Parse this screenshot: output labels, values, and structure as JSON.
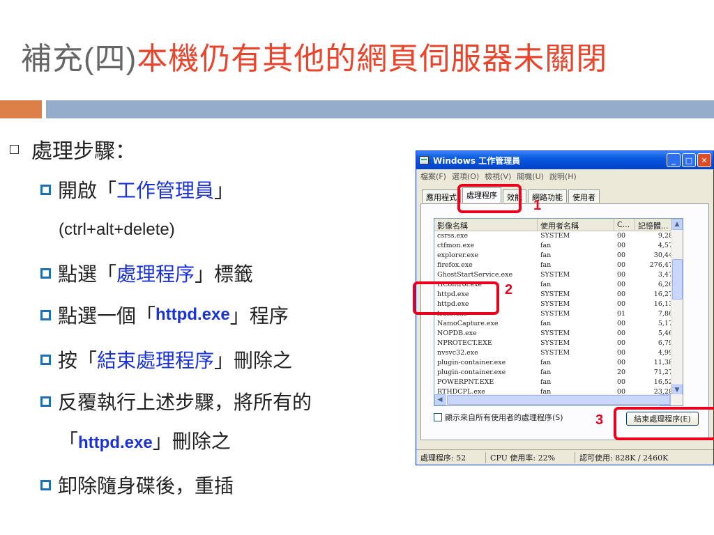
{
  "title": {
    "part1": "補充",
    "part2": "(四)",
    "part3": "本機仍有其他的網頁伺服器未關閉"
  },
  "colors": {
    "accent_orange": "#dd8047",
    "accent_blue": "#94abc9",
    "highlight_red": "#e8001c",
    "link_blue": "#1a32d8"
  },
  "steps": {
    "heading": "處理步驟：",
    "s1": {
      "pre": "開啟「",
      "hl": "工作管理員",
      "post": "」",
      "note": "(ctrl+alt+delete)"
    },
    "s2": {
      "pre": "點選「",
      "hl": "處理程序",
      "post": "」標籤"
    },
    "s3": {
      "pre": "點選一個「",
      "hl": "httpd.exe",
      "post": "」程序"
    },
    "s4": {
      "pre": "按「",
      "hl": "結束處理程序",
      "post": "」刪除之"
    },
    "s5": {
      "line1": "反覆執行上述步驟，將所有的",
      "pre": "「",
      "hl": "httpd.exe",
      "post": "」刪除之"
    },
    "s6": {
      "text": "卸除隨身碟後，重插"
    }
  },
  "taskmgr": {
    "title": "Windows 工作管理員",
    "menu": [
      "檔案(F)",
      "選項(O)",
      "檢視(V)",
      "關機(U)",
      "說明(H)"
    ],
    "tabs": [
      "應用程式",
      "處理程序",
      "效能",
      "網路功能",
      "使用者"
    ],
    "columns": [
      "影像名稱",
      "使用者名稱",
      "C...",
      "記憶體..."
    ],
    "rows": [
      [
        "csrss.exe",
        "SYSTEM",
        "00",
        "9,28"
      ],
      [
        "ctfmon.exe",
        "fan",
        "00",
        "4,57"
      ],
      [
        "explorer.exe",
        "fan",
        "00",
        "30,44"
      ],
      [
        "firefox.exe",
        "fan",
        "00",
        "276,47"
      ],
      [
        "GhostStartService.exe",
        "SYSTEM",
        "00",
        "3,47"
      ],
      [
        "HControl.exe",
        "fan",
        "00",
        "6,26"
      ],
      [
        "httpd.exe",
        "SYSTEM",
        "00",
        "16,27"
      ],
      [
        "httpd.exe",
        "SYSTEM",
        "00",
        "16,13"
      ],
      [
        "lsass.exe",
        "SYSTEM",
        "01",
        "7,86"
      ],
      [
        "NamoCapture.exe",
        "fan",
        "00",
        "5,17"
      ],
      [
        "NOPDB.exe",
        "SYSTEM",
        "00",
        "5,46"
      ],
      [
        "NPROTECT.EXE",
        "SYSTEM",
        "00",
        "6,79"
      ],
      [
        "nvsvc32.exe",
        "SYSTEM",
        "00",
        "4,99"
      ],
      [
        "plugin-container.exe",
        "fan",
        "00",
        "11,38"
      ],
      [
        "plugin-container.exe",
        "fan",
        "20",
        "71,27"
      ],
      [
        "POWERPNT.EXE",
        "fan",
        "00",
        "16,52"
      ],
      [
        "RTHDCPL.exe",
        "fan",
        "00",
        "23,28"
      ]
    ],
    "show_all": "顯示來自所有使用者的處理程序(S)",
    "end_process": "結束處理程序(E)",
    "status": {
      "processes": "處理程序: 52",
      "cpu": "CPU 使用率: 22%",
      "commit": "認可使用: 828K / 2460K"
    }
  },
  "annotations": [
    "1",
    "2",
    "3"
  ]
}
